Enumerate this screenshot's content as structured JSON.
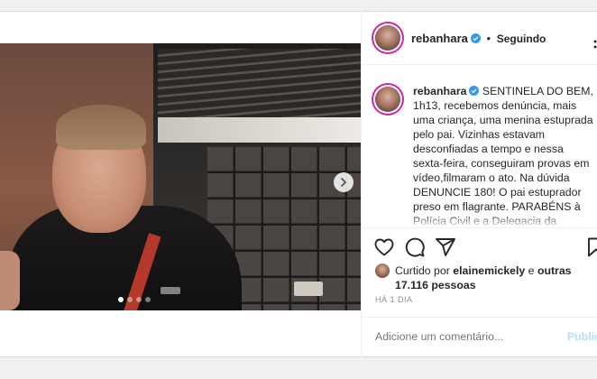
{
  "post": {
    "media": {
      "carousel_index": 1,
      "carousel_total": 4,
      "next_icon": "chevron-right-icon"
    },
    "author": {
      "username": "rebanhara",
      "verified": true,
      "separator": "•",
      "follow_status": "Seguindo"
    },
    "caption": {
      "text": "SENTINELA DO BEM, 1h13, recebemos denúncia, mais uma criança, uma menina estuprada pelo pai. Vizinhas estavam desconfiadas a tempo e nessa sexta-feira, conseguiram provas em vídeo,filmaram o ato. Na dúvida DENUNCIE 180! O pai estuprador preso em flagrante. PARABÉNS à Polícia Civil e a Delegacia da Mulher. Fez o pai de deus com esse..."
    },
    "actions": [
      "heart-icon",
      "comment-icon",
      "share-icon",
      "bookmark-icon"
    ],
    "likes": {
      "prefix": "Curtido por",
      "liker": "elainemickely",
      "connector": "e",
      "others": "outras 17.116 pessoas"
    },
    "time": "HÁ 1 DIA",
    "comment": {
      "placeholder": "Adicione um comentário...",
      "publish_label": "Publicar"
    }
  },
  "colors": {
    "accent": "#0095f6",
    "publish_disabled": "#b2dffc",
    "verified": "#3897f0",
    "muted": "#8e8e8e"
  }
}
